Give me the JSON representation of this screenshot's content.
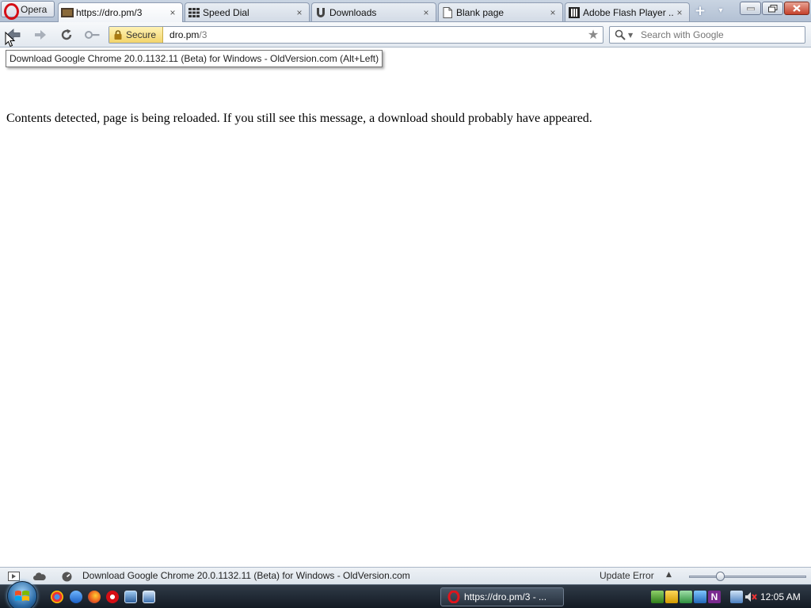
{
  "browser": {
    "menu_label": "Opera",
    "tabs": [
      {
        "label": "https://dro.pm/3",
        "active": true
      },
      {
        "label": "Speed Dial",
        "active": false
      },
      {
        "label": "Downloads",
        "active": false
      },
      {
        "label": "Blank page",
        "active": false
      },
      {
        "label": "Adobe Flash Player ...",
        "active": false
      }
    ],
    "close_glyph": "×"
  },
  "navbar": {
    "security_label": "Secure",
    "url_host": "dro.pm",
    "url_path": "/3",
    "search_placeholder": "Search with Google"
  },
  "tooltip": {
    "text": "Download Google Chrome 20.0.1132.11 (Beta) for Windows - OldVersion.com (Alt+Left)"
  },
  "page": {
    "message": "Contents detected, page is being reloaded. If you still see this message, a download should probably have appeared."
  },
  "statusbar": {
    "text": "Download Google Chrome 20.0.1132.11 (Beta) for Windows - OldVersion.com",
    "update_error": "Update Error",
    "zoom_fraction": 0.27
  },
  "taskbar": {
    "task_label": "https://dro.pm/3 - ...",
    "clock": "12:05 AM"
  },
  "colors": {
    "opera_red": "#d50e15",
    "secure_yellow": "#f2d46a",
    "taskbar_dark": "#141b24"
  }
}
